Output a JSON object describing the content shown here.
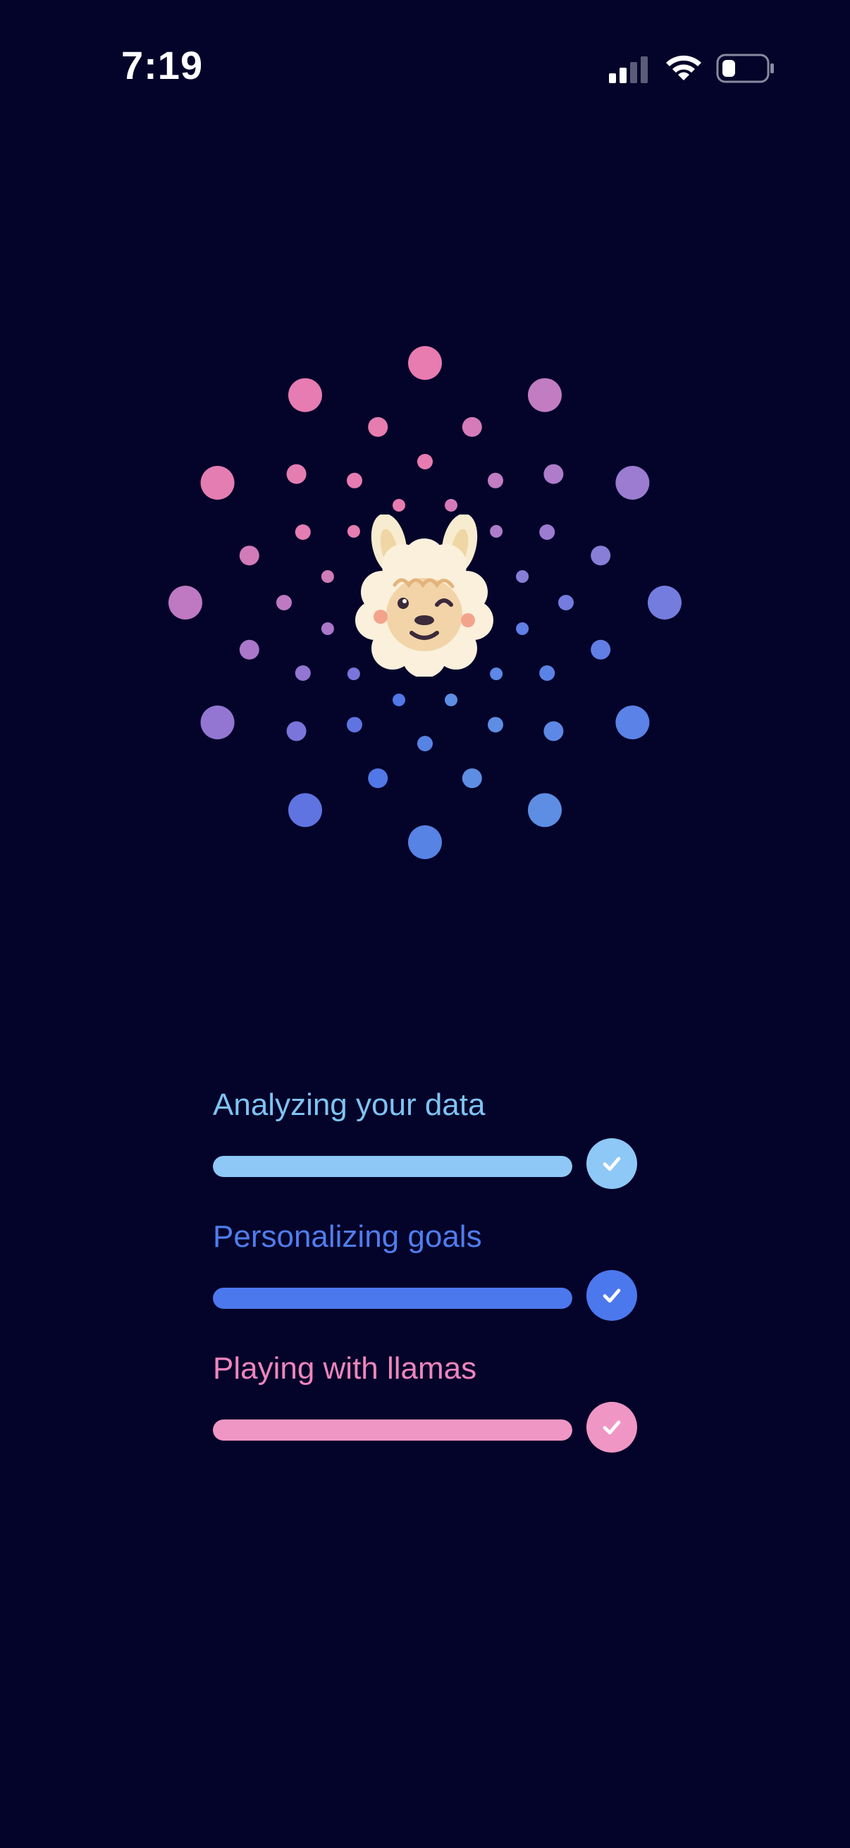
{
  "status_bar": {
    "time": "7:19",
    "icons": [
      "cellular-signal-icon",
      "wifi-icon",
      "battery-icon"
    ]
  },
  "mascot": {
    "icon": "llama-face-icon"
  },
  "colors": {
    "background": "#04032a",
    "pink": "#ee85bd",
    "purple": "#a277cf",
    "blue": "#4b78ed",
    "light_blue": "#8ec8f6"
  },
  "progress_items": [
    {
      "label": "Analyzing your data",
      "progress": 1.0,
      "status": "complete",
      "color": "#8ec8f6"
    },
    {
      "label": "Personalizing goals",
      "progress": 1.0,
      "status": "complete",
      "color": "#4b78ed"
    },
    {
      "label": "Playing with llamas",
      "progress": 1.0,
      "status": "complete",
      "color": "#f096c4"
    }
  ]
}
